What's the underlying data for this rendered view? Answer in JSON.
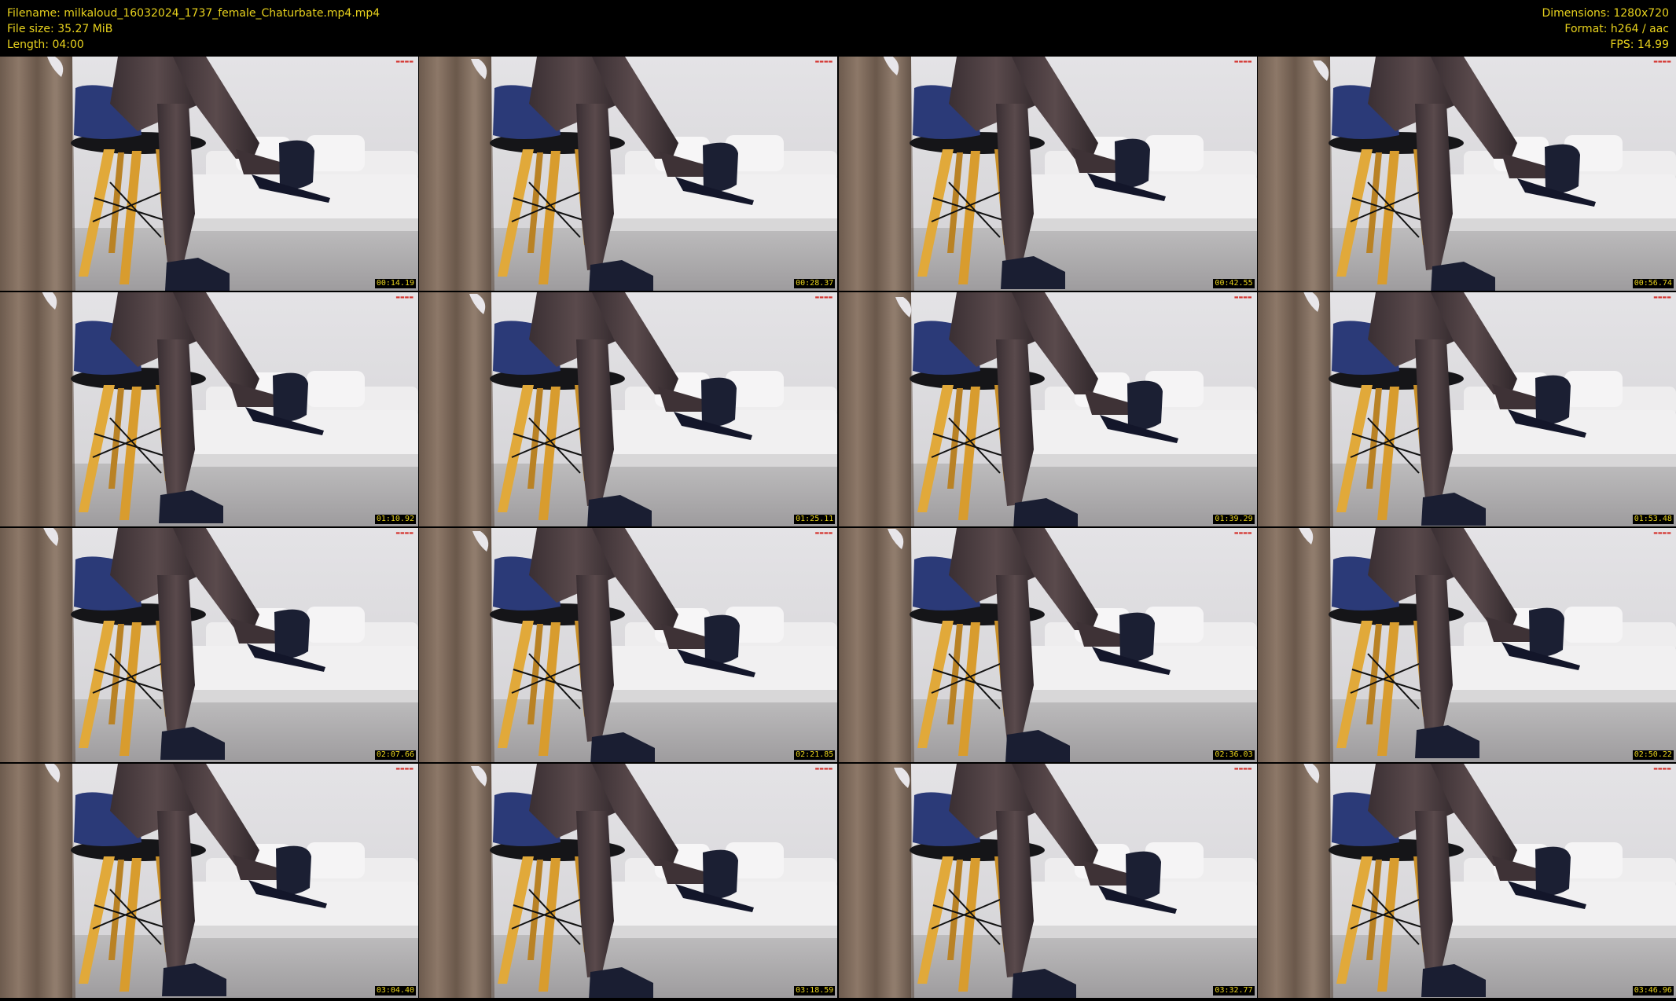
{
  "header": {
    "filename": "Filename: milkaloud_16032024_1737_female_Chaturbate.mp4.mp4",
    "filesize": "File size: 35.27 MiB",
    "length": "Length: 04:00",
    "dimensions": "Dimensions: 1280x720",
    "format": "Format: h264 / aac",
    "fps": "FPS: 14.99"
  },
  "colors": {
    "text_accent": "#e8d21d",
    "background": "#000000",
    "watermark": "#d4332e"
  },
  "frames": [
    {
      "timestamp": "00:14.19"
    },
    {
      "timestamp": "00:28.37"
    },
    {
      "timestamp": "00:42.55"
    },
    {
      "timestamp": "00:56.74"
    },
    {
      "timestamp": "01:10.92"
    },
    {
      "timestamp": "01:25.11"
    },
    {
      "timestamp": "01:39.29"
    },
    {
      "timestamp": "01:53.48"
    },
    {
      "timestamp": "02:07.66"
    },
    {
      "timestamp": "02:21.85"
    },
    {
      "timestamp": "02:36.03"
    },
    {
      "timestamp": "02:50.22"
    },
    {
      "timestamp": "03:04.40"
    },
    {
      "timestamp": "03:18.59"
    },
    {
      "timestamp": "03:32.77"
    },
    {
      "timestamp": "03:46.96"
    }
  ]
}
